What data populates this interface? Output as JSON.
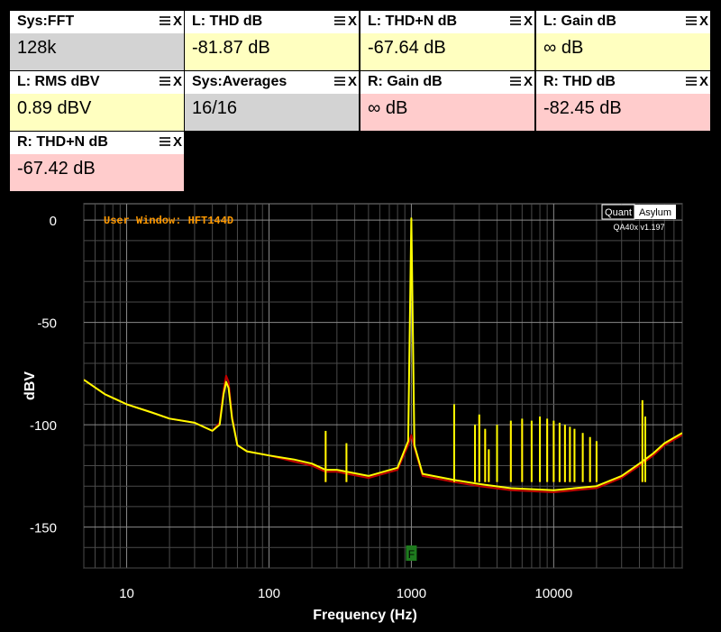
{
  "tiles": [
    {
      "title": "Sys:FFT",
      "value": "128k",
      "bg": "#d3d3d3"
    },
    {
      "title": "L: THD dB",
      "value": "-81.87 dB",
      "bg": "#ffffc0"
    },
    {
      "title": "L: THD+N dB",
      "value": "-67.64 dB",
      "bg": "#ffffc0"
    },
    {
      "title": "L: Gain dB",
      "value": "∞ dB",
      "bg": "#ffffc0"
    },
    {
      "title": "L: RMS dBV",
      "value": "0.89 dBV",
      "bg": "#ffffc0"
    },
    {
      "title": "Sys:Averages",
      "value": "16/16",
      "bg": "#d3d3d3"
    },
    {
      "title": "R: Gain dB",
      "value": "∞ dB",
      "bg": "#ffcccc"
    },
    {
      "title": "R: THD dB",
      "value": "-82.45 dB",
      "bg": "#ffcccc"
    },
    {
      "title": "R: THD+N dB",
      "value": "-67.42 dB",
      "bg": "#ffcccc"
    }
  ],
  "tile_icons": {
    "menu": "menu-icon",
    "close": "close-icon",
    "close_glyph": "X"
  },
  "chart_data": {
    "type": "line",
    "xscale": "log",
    "xlim": [
      5,
      80000
    ],
    "ylim": [
      -170,
      8
    ],
    "xlabel": "Frequency (Hz)",
    "ylabel": "dBV",
    "xticks": [
      10,
      100,
      1000,
      10000
    ],
    "xtick_labels": [
      "10",
      "100",
      "1000",
      "10000"
    ],
    "yticks": [
      0,
      -50,
      -100,
      -150
    ],
    "ytick_labels": [
      "0",
      "-50",
      "-100",
      "-150"
    ],
    "grid": true,
    "annotation": "User Window: HFT144D",
    "logo": {
      "left": "Quant",
      "right": "Asylum",
      "version": "QA40x v1.197"
    },
    "marker": {
      "label": "F",
      "x": 1000,
      "color": "#1e7a1e"
    },
    "colors": {
      "left": "#ffff00",
      "right": "#c00000",
      "annotation": "#ff9900"
    },
    "series": [
      {
        "channel": "right",
        "x": [
          5,
          7,
          10,
          15,
          20,
          30,
          40,
          45,
          48,
          50,
          52,
          55,
          60,
          70,
          100,
          150,
          200,
          250,
          300,
          500,
          800,
          950,
          1000,
          1050,
          1200,
          2000,
          3000,
          5000,
          10000,
          20000,
          30000,
          40000,
          50000,
          60000,
          80000
        ],
        "values": [
          -78,
          -85,
          -90,
          -94,
          -97,
          -99,
          -103,
          -99,
          -83,
          -76,
          -79,
          -96,
          -110,
          -113,
          -115,
          -118,
          -120,
          -123,
          -123,
          -126,
          -122,
          -110,
          -105,
          -111,
          -125,
          -128,
          -130,
          -132,
          -133,
          -131,
          -126,
          -120,
          -115,
          -110,
          -105
        ]
      },
      {
        "channel": "left",
        "x": [
          5,
          7,
          10,
          15,
          20,
          30,
          40,
          45,
          48,
          50,
          52,
          55,
          60,
          70,
          100,
          150,
          200,
          250,
          300,
          500,
          800,
          950,
          1000,
          1050,
          1200,
          2000,
          3000,
          5000,
          10000,
          20000,
          30000,
          40000,
          50000,
          60000,
          80000
        ],
        "values": [
          -78,
          -85,
          -90,
          -94,
          -97,
          -99,
          -103,
          -100,
          -85,
          -79,
          -82,
          -97,
          -110,
          -113,
          -115,
          -117,
          -119,
          -122,
          -122,
          -125,
          -121,
          -108,
          0.9,
          -110,
          -124,
          -127,
          -129,
          -131,
          -132,
          -130,
          -125,
          -119,
          -114,
          -109,
          -104
        ]
      }
    ],
    "spikes": [
      {
        "x": 250,
        "values": [
          -103,
          -104
        ]
      },
      {
        "x": 350,
        "values": [
          -109,
          -110
        ]
      },
      {
        "x": 2000,
        "values": [
          -90,
          -92
        ]
      },
      {
        "x": 2800,
        "values": [
          -100,
          -101
        ]
      },
      {
        "x": 3000,
        "values": [
          -95,
          -96
        ]
      },
      {
        "x": 3300,
        "values": [
          -102,
          -103
        ]
      },
      {
        "x": 3500,
        "values": [
          -112,
          -113
        ]
      },
      {
        "x": 4000,
        "values": [
          -100,
          -101
        ]
      },
      {
        "x": 5000,
        "values": [
          -98,
          -99
        ]
      },
      {
        "x": 6000,
        "values": [
          -97,
          -98
        ]
      },
      {
        "x": 7000,
        "values": [
          -98,
          -99
        ]
      },
      {
        "x": 8000,
        "values": [
          -96,
          -97
        ]
      },
      {
        "x": 9000,
        "values": [
          -97,
          -98
        ]
      },
      {
        "x": 10000,
        "values": [
          -98,
          -99
        ]
      },
      {
        "x": 11000,
        "values": [
          -99,
          -100
        ]
      },
      {
        "x": 12000,
        "values": [
          -100,
          -101
        ]
      },
      {
        "x": 13000,
        "values": [
          -101,
          -102
        ]
      },
      {
        "x": 14000,
        "values": [
          -102,
          -103
        ]
      },
      {
        "x": 16000,
        "values": [
          -104,
          -105
        ]
      },
      {
        "x": 18000,
        "values": [
          -106,
          -107
        ]
      },
      {
        "x": 20000,
        "values": [
          -108,
          -109
        ]
      },
      {
        "x": 42000,
        "values": [
          -88,
          -89
        ]
      },
      {
        "x": 44000,
        "values": [
          -96,
          -97
        ]
      }
    ]
  }
}
